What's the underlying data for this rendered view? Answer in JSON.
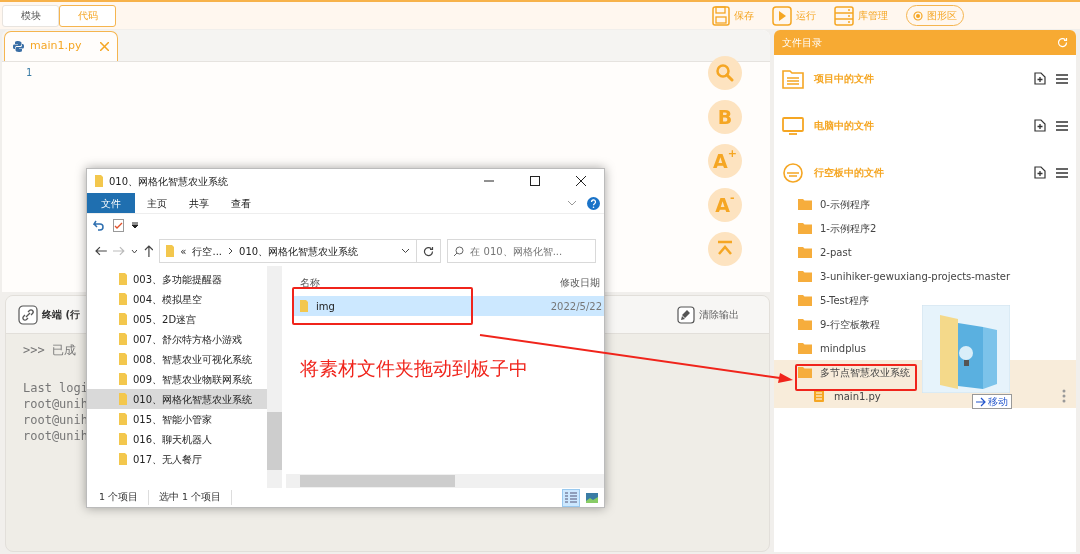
{
  "mode_tabs": [
    {
      "label": "模块",
      "selected": false
    },
    {
      "label": "代码",
      "selected": true
    }
  ],
  "toolbar": [
    {
      "kind": "save",
      "label": "保存"
    },
    {
      "kind": "run",
      "label": "运行"
    },
    {
      "kind": "library",
      "label": "库管理"
    },
    {
      "kind": "pill",
      "label": "图形区"
    }
  ],
  "editor": {
    "tab": {
      "label": "main1.py"
    },
    "line_numbers": [
      "1"
    ],
    "side_buttons": [
      {
        "kind": "search"
      },
      {
        "kind": "text",
        "label": "B"
      },
      {
        "kind": "text",
        "label": "A$^{+}$"
      },
      {
        "kind": "text",
        "label": "A$^{-}$"
      },
      {
        "kind": "collapse"
      }
    ]
  },
  "terminal": {
    "title": "终端 (行",
    "clear_button": "清除输出",
    "blocks": [
      [
        ">>> 已成"
      ],
      [
        "Last logi",
        "root@unih",
        "root@unih",
        "root@unih"
      ]
    ]
  },
  "file_panel": {
    "title": "文件目录",
    "sections": [
      {
        "kind": "project",
        "label": "项目中的文件"
      },
      {
        "kind": "computer",
        "label": "电脑中的文件"
      },
      {
        "kind": "board",
        "label": "行空板中的文件"
      }
    ],
    "tree": [
      {
        "label": "0-示例程序",
        "highlighted": false
      },
      {
        "label": "1-示例程序2",
        "highlighted": false
      },
      {
        "label": "2-past",
        "highlighted": false
      },
      {
        "label": "3-unihiker-gewuxiang-projects-master",
        "highlighted": false
      },
      {
        "label": "5-Test程序",
        "highlighted": false
      },
      {
        "label": "9-行空板教程",
        "highlighted": false
      },
      {
        "label": "mindplus",
        "highlighted": false
      },
      {
        "label": "多节点智慧农业系统",
        "highlighted": true,
        "children": [
          {
            "label": "main1.py"
          }
        ]
      }
    ]
  },
  "drag": {
    "tooltip": "移动"
  },
  "explorer": {
    "title": "010、网格化智慧农业系统",
    "ribbon_tabs": [
      {
        "label": "文件",
        "selected": true
      },
      {
        "label": "主页",
        "selected": false
      },
      {
        "label": "共享",
        "selected": false
      },
      {
        "label": "查看",
        "selected": false
      }
    ],
    "address": {
      "overflow": "«",
      "segments": [
        "行空...",
        "010、网格化智慧农业系统"
      ]
    },
    "search": {
      "placeholder": "在 010、网格化智..."
    },
    "nav_items": [
      {
        "label": "003、多功能提醒器",
        "selected": false
      },
      {
        "label": "004、模拟星空",
        "selected": false
      },
      {
        "label": "005、2D迷宫",
        "selected": false
      },
      {
        "label": "007、舒尔特方格小游戏",
        "selected": false
      },
      {
        "label": "008、智慧农业可视化系统",
        "selected": false
      },
      {
        "label": "009、智慧农业物联网系统",
        "selected": false
      },
      {
        "label": "010、网格化智慧农业系统",
        "selected": true
      },
      {
        "label": "015、智能小管家",
        "selected": false
      },
      {
        "label": "016、聊天机器人",
        "selected": false
      },
      {
        "label": "017、无人餐厅",
        "selected": false
      }
    ],
    "columns": [
      "名称",
      "修改日期"
    ],
    "rows": [
      {
        "name": "img",
        "modified": "2022/5/22",
        "selected": true
      }
    ],
    "status": [
      "1 个项目",
      "选中 1 个项目"
    ],
    "views": [
      {
        "kind": "details",
        "selected": true
      },
      {
        "kind": "thumbnails",
        "selected": false
      }
    ]
  },
  "annotation": {
    "text": "将素材文件夹拖动到板子中"
  }
}
